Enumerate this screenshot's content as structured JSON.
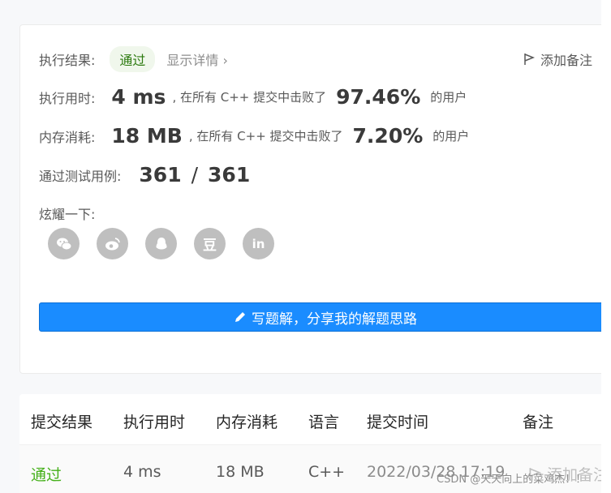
{
  "result": {
    "label": "执行结果:",
    "status": "通过",
    "detail_link": "显示详情 ›",
    "note_label": "添加备注"
  },
  "runtime": {
    "label": "执行用时:",
    "value": "4 ms",
    "mid_text": ", 在所有 C++ 提交中击败了",
    "percent": "97.46%",
    "suffix": "的用户"
  },
  "memory": {
    "label": "内存消耗:",
    "value": "18 MB",
    "mid_text": ", 在所有 C++ 提交中击败了",
    "percent": "7.20%",
    "suffix": "的用户"
  },
  "tests": {
    "label": "通过测试用例:",
    "passed": "361",
    "sep": "/",
    "total": "361"
  },
  "share": {
    "label": "炫耀一下:",
    "icons": [
      "wechat-icon",
      "weibo-icon",
      "qq-icon",
      "douban-icon",
      "linkedin-icon"
    ],
    "douban_glyph": "豆",
    "linkedin_glyph": "in"
  },
  "write_button": {
    "label": "写题解，分享我的解题思路"
  },
  "table": {
    "headers": [
      "提交结果",
      "执行用时",
      "内存消耗",
      "语言",
      "提交时间",
      "备注"
    ],
    "rows": [
      {
        "result": "通过",
        "runtime": "4 ms",
        "memory": "18 MB",
        "language": "C++",
        "time": "2022/03/28 17:19",
        "note": "添加备注"
      }
    ]
  },
  "watermark": "CSDN @天天向上的菜鸡杰！！",
  "colors": {
    "accent": "#1a8cff",
    "pass": "#45b01a",
    "icon_gray": "#bfbfbf"
  }
}
